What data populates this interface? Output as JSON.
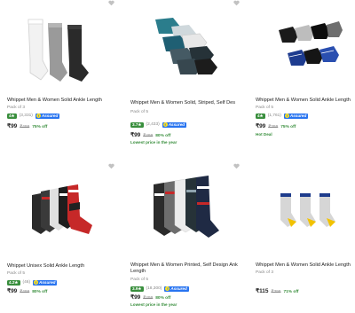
{
  "colors": {
    "rating_green": "#388e3c",
    "assured_blue": "#2874f0",
    "offer_green": "#388e3c"
  },
  "icons": {
    "wishlist": "heart-icon",
    "rating": "star-icon",
    "assured": "flipkart-assured-icon"
  },
  "products": [
    {
      "title": "Whippet Men & Women Solid Ankle Length",
      "pack": "Pack of 3",
      "rating": "4★",
      "count": "(3,331)",
      "assured": "Assured",
      "price": "₹99",
      "mrp": "₹499",
      "off": "75% off",
      "tag": ""
    },
    {
      "title": "Whippet Men & Women Solid, Striped, Self Design, Printe...",
      "pack": "Pack of 5",
      "rating": "3.7★",
      "count": "(2,433)",
      "assured": "Assured",
      "price": "₹99",
      "mrp": "₹499",
      "off": "80% off",
      "tag": "Lowest price in the year"
    },
    {
      "title": "Whippet Men & Women Solid Ankle Length",
      "pack": "Pack of 5",
      "rating": "4★",
      "count": "(1,761)",
      "assured": "Assured",
      "price": "₹99",
      "mrp": "₹399",
      "off": "75% off",
      "tag": "Hot Deal"
    },
    {
      "title": "Whippet Unisex Solid Ankle Length",
      "pack": "Pack of 5",
      "rating": "4.2★",
      "count": "(46)",
      "assured": "Assured",
      "price": "₹99",
      "mrp": "₹499",
      "off": "80% off",
      "tag": ""
    },
    {
      "title": "Whippet Men & Women Printed, Self Design Ankle",
      "title2": "Length",
      "pack": "Pack of 5",
      "rating": "3.9★",
      "count": "(18,300)",
      "assured": "Assured",
      "price": "₹99",
      "mrp": "₹499",
      "off": "80% off",
      "tag": "Lowest price in the year"
    },
    {
      "title": "Whippet Men & Women Solid Ankle Length",
      "pack": "Pack of 3",
      "rating": "",
      "count": "",
      "assured": "",
      "price": "₹115",
      "mrp": "₹399",
      "off": "71% off",
      "tag": ""
    }
  ]
}
